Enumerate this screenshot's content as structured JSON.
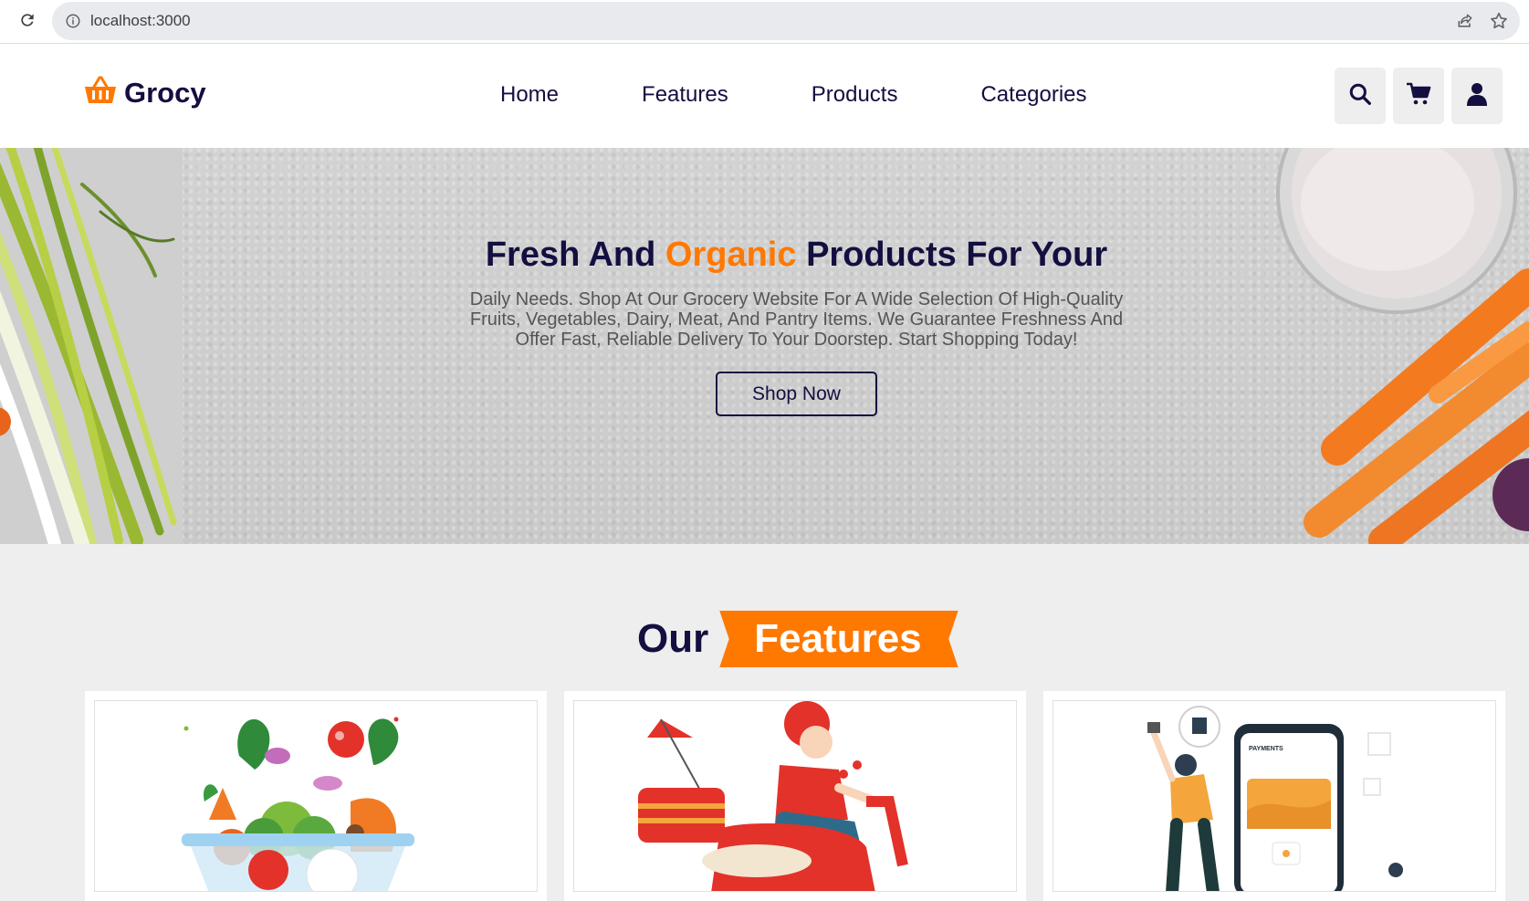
{
  "browser": {
    "url": "localhost:3000",
    "icons": [
      "reload-icon",
      "info-icon",
      "share-icon",
      "star-icon"
    ]
  },
  "header": {
    "logo_text": "Grocy",
    "logo_icon": "basket-icon",
    "nav": [
      {
        "label": "Home"
      },
      {
        "label": "Features"
      },
      {
        "label": "Products"
      },
      {
        "label": "Categories"
      }
    ],
    "icons": [
      "search-icon",
      "cart-icon",
      "user-icon"
    ]
  },
  "hero": {
    "title_part1": "Fresh And",
    "title_accent": "Organic",
    "title_part2": "Products For Your",
    "description": "Daily Needs. Shop At Our Grocery Website For A Wide Selection Of High-Quality Fruits, Vegetables, Dairy, Meat, And Pantry Items. We Guarantee Freshness And Offer Fast, Reliable Delivery To Your Doorstep. Start Shopping Today!",
    "button_label": "Shop Now"
  },
  "features": {
    "heading_plain": "Our",
    "heading_accent": "Features",
    "cards": [
      {
        "image": "fresh-vegetables-basket-illustration"
      },
      {
        "image": "delivery-scooter-illustration"
      },
      {
        "image": "mobile-payment-illustration",
        "phone_title": "PAYMENTS"
      }
    ]
  },
  "colors": {
    "primary": "#130f40",
    "accent": "#ff7800",
    "background": "#eeeeee"
  }
}
